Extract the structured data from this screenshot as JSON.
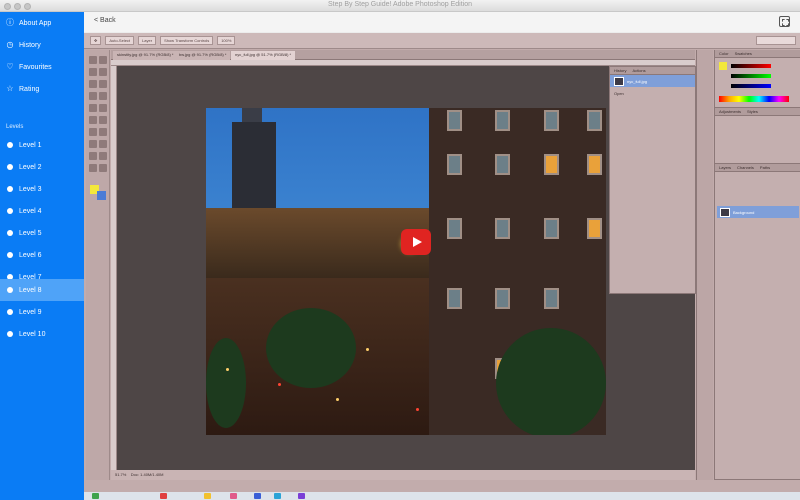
{
  "window": {
    "title": "Step By Step Guide! Adobe Photoshop Edition"
  },
  "sidebar": {
    "items": [
      {
        "label": "About App",
        "icon": "info-icon"
      },
      {
        "label": "History",
        "icon": "clock-icon"
      },
      {
        "label": "Favourites",
        "icon": "heart-icon"
      },
      {
        "label": "Rating",
        "icon": "star-icon"
      }
    ],
    "section_label": "Levels",
    "levels": [
      {
        "label": "Level 1"
      },
      {
        "label": "Level 2"
      },
      {
        "label": "Level 3"
      },
      {
        "label": "Level 4"
      },
      {
        "label": "Level 5"
      },
      {
        "label": "Level 6"
      },
      {
        "label": "Level 7"
      },
      {
        "label": "Level 8",
        "active": true
      },
      {
        "label": "Level 9"
      },
      {
        "label": "Level 10"
      }
    ]
  },
  "header": {
    "back_label": "< Back"
  },
  "colors": {
    "sidebar_bg": "#0a7cf5",
    "sidebar_active": "#4fa3f8",
    "play_button": "#e02421"
  },
  "photoshop": {
    "tabs": [
      "skinstity.jpg @ 91.7% (RGB/8) *",
      "bw.jpg @ 91.7% (RGB/8) *",
      "nyc_full.jpg @ 51.7% (RGB/8) *"
    ],
    "options": [
      "Auto-Select",
      "Layer",
      "Show Transform Controls"
    ],
    "panels": {
      "history_tabs": [
        "History",
        "Actions"
      ],
      "color_tabs": [
        "Color",
        "Swatches"
      ],
      "adjust_tabs": [
        "Adjustments",
        "Styles"
      ],
      "layer_tabs": [
        "Layers",
        "Channels",
        "Paths"
      ]
    },
    "history_items": [
      "nyc_full.jpg",
      "Open"
    ],
    "layer_name": "Background",
    "opacity": "100%",
    "zoom": "51.7%",
    "doc_size": "Doc: 1.40M/1.40M"
  }
}
